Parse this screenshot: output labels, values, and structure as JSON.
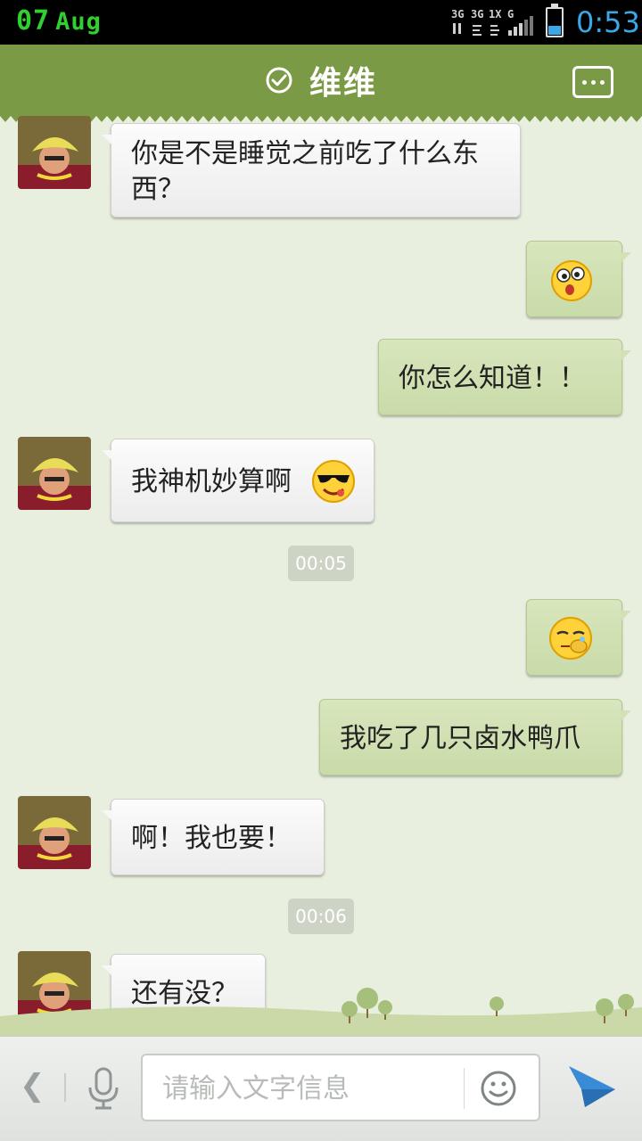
{
  "status_bar": {
    "date_day": "07",
    "date_month": "Aug",
    "time": "0:53",
    "battery_level": 0.35,
    "icons": [
      "3g-icon",
      "3g-icon",
      "1x-icon",
      "g-icon",
      "signal-icon",
      "battery-icon"
    ]
  },
  "header": {
    "title": "维维",
    "verified_icon": "check-circle-icon",
    "menu_icon": "more-dots-icon",
    "color": "#7b9a45"
  },
  "messages": [
    {
      "side": "in",
      "text": "你是不是睡觉之前吃了什么东西？"
    },
    {
      "side": "out",
      "emoji": "surprised-emoji-icon"
    },
    {
      "side": "out",
      "text": "你怎么知道！！"
    },
    {
      "side": "in",
      "text": "我神机妙算啊",
      "emoji": "cool-sunglasses-emoji-icon"
    },
    {
      "side": "time",
      "text": "00:05"
    },
    {
      "side": "out",
      "emoji": "shy-covering-face-emoji-icon"
    },
    {
      "side": "out",
      "text": "我吃了几只卤水鸭爪"
    },
    {
      "side": "in",
      "text": "啊！我也要！"
    },
    {
      "side": "time",
      "text": "00:06"
    },
    {
      "side": "in",
      "text": "还有没？"
    }
  ],
  "input_bar": {
    "placeholder": "请输入文字信息",
    "value": ""
  },
  "colors": {
    "incoming_bubble": "#f4f4f4",
    "outgoing_bubble": "#d2e2b5",
    "background": "#e9efdf",
    "time_accent": "#3aa7e6"
  }
}
